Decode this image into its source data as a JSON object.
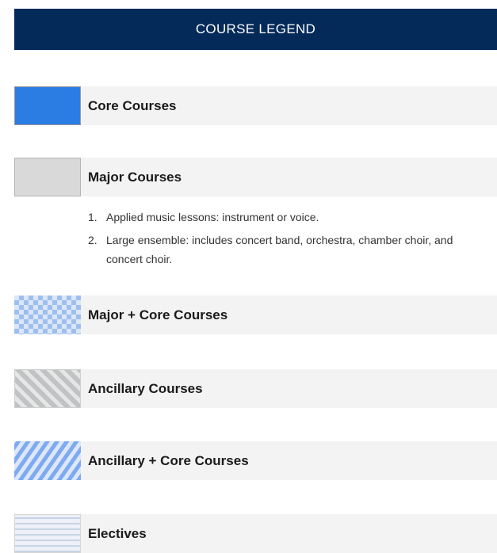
{
  "header": {
    "title": "COURSE LEGEND"
  },
  "legend": {
    "items": [
      {
        "label": "Core Courses",
        "pattern": "solid",
        "color": "#2b7de3"
      },
      {
        "label": "Major Courses",
        "pattern": "solid",
        "color": "#d9d9d9"
      },
      {
        "label": "Major + Core Courses",
        "pattern": "checkerboard",
        "color": "#9dbff0"
      },
      {
        "label": "Ancillary Courses",
        "pattern": "diagonal-stripes",
        "color": "#bfc3c3"
      },
      {
        "label": "Ancillary + Core Courses",
        "pattern": "diagonal-stripes",
        "color": "#7faaf0"
      },
      {
        "label": "Electives",
        "pattern": "horizontal-stripes",
        "color": "#c8d3e6"
      }
    ],
    "notes": [
      {
        "number": "1.",
        "text": "Applied music lessons: instrument or voice."
      },
      {
        "number": "2.",
        "text": "Large ensemble: includes concert band, orchestra, chamber choir, and concert choir."
      }
    ]
  },
  "colors": {
    "header_bg": "#032a58",
    "label_bg": "#f3f3f3"
  }
}
